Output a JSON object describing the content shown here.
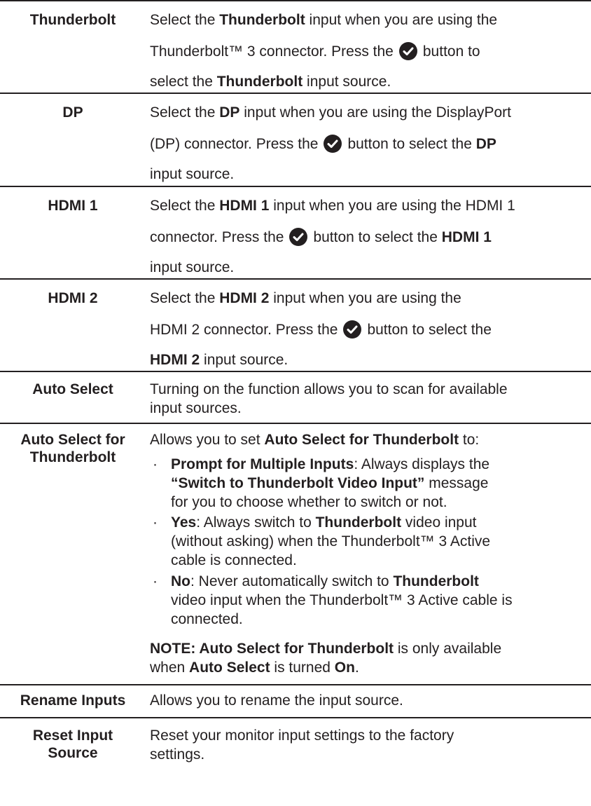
{
  "rows": {
    "thunderbolt": {
      "term": "Thunderbolt",
      "l1a": "Select the ",
      "l1b": "Thunderbolt",
      "l1c": " input when you are using the",
      "l2a": "Thunderbolt™ 3 connector. Press the",
      "l2b": "button to",
      "l3a": "select the ",
      "l3b": "Thunderbolt",
      "l3c": " input source."
    },
    "dp": {
      "term": "DP",
      "l1a": "Select the ",
      "l1b": "DP",
      "l1c": " input when you are using the DisplayPort",
      "l2a": "(DP) connector. Press the",
      "l2b": "button to select the ",
      "l2c": "DP",
      "l3a": "input source."
    },
    "hdmi1": {
      "term": "HDMI 1",
      "l1a": "Select the ",
      "l1b": "HDMI 1",
      "l1c": " input when you are using the HDMI 1",
      "l2a": "connector. Press the",
      "l2b": "button to select the ",
      "l2c": "HDMI 1",
      "l3a": "input source."
    },
    "hdmi2": {
      "term": "HDMI 2",
      "l1a": "Select the ",
      "l1b": "HDMI 2",
      "l1c": " input when you are using the",
      "l2a": "HDMI 2 connector. Press the",
      "l2b": "button to select the",
      "l3a": "HDMI 2",
      "l3b": " input source."
    },
    "auto_select": {
      "term": "Auto Select",
      "l1": "Turning on the function allows you to scan for available",
      "l2": "input sources."
    },
    "auto_select_tb": {
      "term1": "Auto Select for",
      "term2": "Thunderbolt",
      "intro_a": "Allows you to set ",
      "intro_b": "Auto Select for Thunderbolt",
      "intro_c": " to:",
      "b1_a": "Prompt for Multiple Inputs",
      "b1_b": ": Always displays the",
      "b1_c": "“Switch to Thunderbolt Video Input”",
      "b1_d": " message",
      "b1_e": "for you to choose whether to switch or not.",
      "b2_a": "Yes",
      "b2_b": ": Always switch to ",
      "b2_c": "Thunderbolt",
      "b2_d": " video input",
      "b2_e": "(without asking) when the Thunderbolt™ 3 Active",
      "b2_f": "cable is connected.",
      "b3_a": "No",
      "b3_b": ": Never automatically switch to ",
      "b3_c": "Thunderbolt",
      "b3_d": "video input when the Thunderbolt™ 3 Active cable is",
      "b3_e": "connected.",
      "note_a": "NOTE: Auto Select for Thunderbolt",
      "note_b": " is only available",
      "note_c": "when ",
      "note_d": "Auto Select",
      "note_e": " is turned ",
      "note_f": "On",
      "note_g": "."
    },
    "rename": {
      "term": "Rename Inputs",
      "l1": "Allows you to rename the input source."
    },
    "reset": {
      "term1": "Reset Input",
      "term2": "Source",
      "l1": "Reset your monitor input settings to the factory",
      "l2": "settings."
    }
  },
  "icons": {
    "confirm": "check-circle-icon"
  },
  "colors": {
    "text": "#231f20",
    "rule": "#231f20"
  }
}
